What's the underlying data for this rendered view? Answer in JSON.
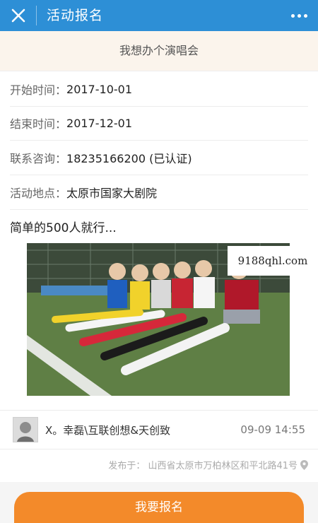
{
  "header": {
    "title": "活动报名",
    "bg_color": "#2d8fd6"
  },
  "event": {
    "name": "我想办个演唱会",
    "start": {
      "label": "开始时间：",
      "value": "2017-10-01"
    },
    "end": {
      "label": "结束时间：",
      "value": "2017-12-01"
    },
    "contact": {
      "label": "联系咨询：",
      "value": "18235166200 (已认证)"
    },
    "place": {
      "label": "活动地点：",
      "value": "太原市国家大剧院"
    },
    "description": "简单的500人就行..."
  },
  "image": {
    "watermark": "9188qhl.com"
  },
  "post": {
    "username": "X。幸磊\\互联创想&天创致",
    "time": "09-09 14:55",
    "location": "发布于：  山西省太原市万柏林区和平北路41号"
  },
  "action": {
    "signup_label": "我要报名",
    "color": "#f38a2a"
  }
}
